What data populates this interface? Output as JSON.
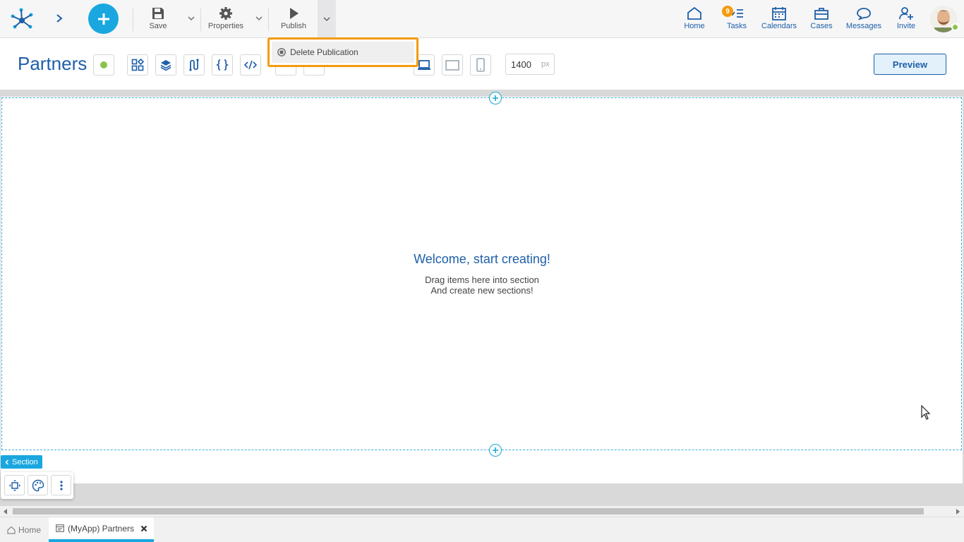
{
  "toolbar": {
    "save_label": "Save",
    "properties_label": "Properties",
    "publish_label": "Publish"
  },
  "nav": {
    "home": "Home",
    "tasks": "Tasks",
    "tasks_badge": "9",
    "calendars": "Calendars",
    "cases": "Cases",
    "messages": "Messages",
    "invite": "Invite"
  },
  "dropdown": {
    "delete_publication": "Delete Publication"
  },
  "editor": {
    "page_title": "Partners",
    "width_value": "1400",
    "width_unit": "px",
    "preview_label": "Preview"
  },
  "canvas": {
    "welcome_title": "Welcome, start creating!",
    "welcome_line1": "Drag items here into section",
    "welcome_line2": "And create new sections!",
    "section_tag": "Section"
  },
  "tabs": {
    "home": "Home",
    "partners": "(MyApp) Partners"
  },
  "colors": {
    "accent": "#1aa7e0",
    "brand_blue": "#1f5fa8",
    "highlight": "#f59a0c",
    "status_green": "#8bc34a"
  }
}
